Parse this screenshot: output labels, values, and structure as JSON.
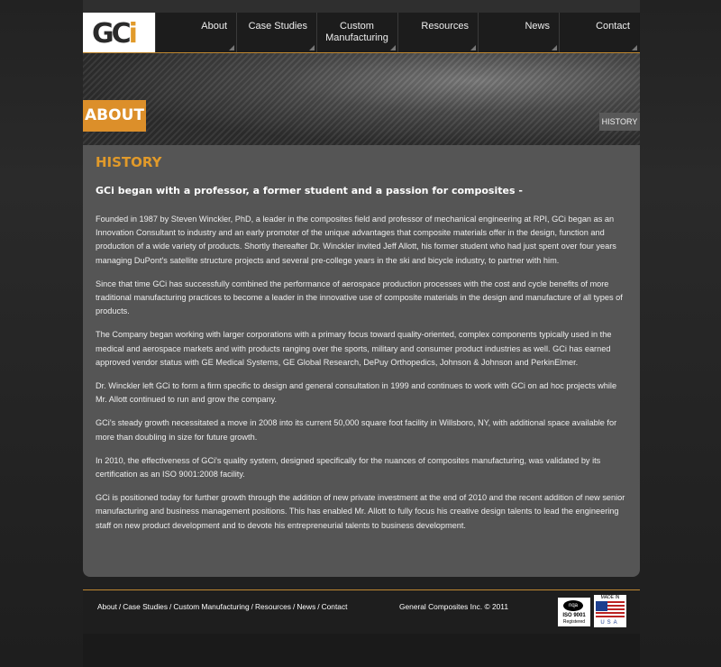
{
  "logo": {
    "text_main": "GC",
    "text_accent": "i"
  },
  "nav": [
    {
      "label": "About"
    },
    {
      "label": "Case Studies"
    },
    {
      "label": "Custom Manufacturing"
    },
    {
      "label": "Resources"
    },
    {
      "label": "News"
    },
    {
      "label": "Contact"
    }
  ],
  "banner": {
    "section_label": "ABOUT",
    "subnav_label": "HISTORY"
  },
  "content": {
    "heading": "HISTORY",
    "lead": "GCi began with a professor, a former student and a passion for composites -",
    "paragraphs": [
      "Founded in 1987 by Steven Winckler, PhD, a leader in the composites field and professor of mechanical engineering at RPI, GCi began as an Innovation Consultant to industry and an early promoter of the unique advantages that composite materials offer in the design, function and production of a wide variety of products. Shortly thereafter Dr. Winckler invited Jeff Allott, his former student who had just spent over four years managing DuPont's satellite structure projects and several pre-college years in the ski and bicycle industry, to partner with him.",
      "Since that time GCi has successfully combined the performance of aerospace production processes with the cost and cycle benefits of more traditional manufacturing practices to become a leader in the innovative use of composite materials in the design and manufacture of all types of products.",
      "The Company began working with larger corporations with a primary focus toward quality-oriented, complex components typically used in the medical and aerospace markets and with products ranging over the sports, military and consumer product industries as well. GCi has earned approved vendor status with GE Medical Systems, GE Global Research, DePuy Orthopedics, Johnson & Johnson and PerkinElmer.",
      "Dr. Winckler left GCi to form a firm specific to design and general consultation in 1999 and continues to work with GCi on ad hoc projects while Mr. Allott continued to run and grow the company.",
      "GCi's steady growth necessitated a move in 2008 into its current 50,000 square foot facility in Willsboro, NY, with additional space available for more than doubling in size for future growth.",
      "In 2010, the effectiveness of GCi's quality system, designed specifically for the nuances of composites manufacturing, was validated by its certification as an ISO 9001:2008 facility.",
      "GCi is positioned today for further growth through the addition of new private investment at the end of 2010 and the recent addition of new senior manufacturing and business management positions. This has enabled Mr. Allott to fully focus his creative design talents to lead the engineering staff on new product development and to devote his entrepreneurial talents to business development."
    ]
  },
  "footer": {
    "links": [
      "About",
      "Case Studies",
      "Custom Manufacturing",
      "Resources",
      "News",
      "Contact"
    ],
    "separator": "/",
    "copyright": "General Composites Inc. © 2011",
    "iso_badge": {
      "logo_text": "nqa",
      "line1": "ISO 9001",
      "line2": "Registered"
    },
    "usa_badge": {
      "top": "MADE IN",
      "bottom": "USA"
    }
  },
  "colors": {
    "accent": "#dc8f2a",
    "content_bg": "#555555",
    "header_bg": "#1a1a1a"
  }
}
